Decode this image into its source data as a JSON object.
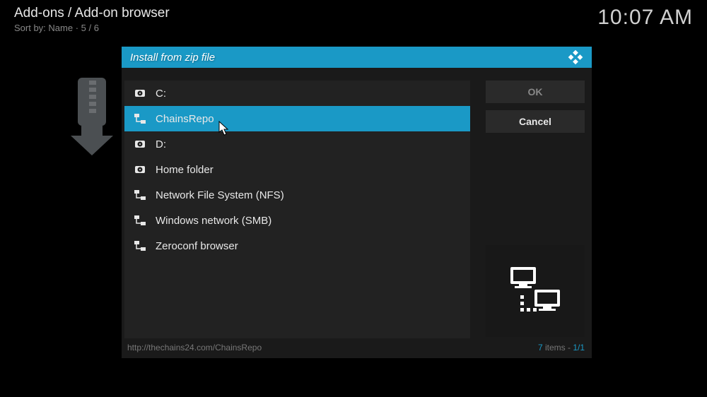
{
  "header": {
    "breadcrumb": "Add-ons / Add-on browser",
    "sort_info": "Sort by: Name  ·  5 / 6",
    "clock": "10:07 AM"
  },
  "dialog": {
    "title": "Install from zip file",
    "files": [
      {
        "label": "C:",
        "icon": "drive",
        "selected": false
      },
      {
        "label": "ChainsRepo",
        "icon": "network",
        "selected": true
      },
      {
        "label": "D:",
        "icon": "drive",
        "selected": false
      },
      {
        "label": "Home folder",
        "icon": "drive",
        "selected": false
      },
      {
        "label": "Network File System (NFS)",
        "icon": "network",
        "selected": false
      },
      {
        "label": "Windows network (SMB)",
        "icon": "network",
        "selected": false
      },
      {
        "label": "Zeroconf browser",
        "icon": "network",
        "selected": false
      }
    ],
    "buttons": {
      "ok": "OK",
      "cancel": "Cancel"
    },
    "footer": {
      "path": "http://thechains24.com/ChainsRepo",
      "item_count": "7",
      "items_text": " items - ",
      "page": "1/1"
    }
  }
}
